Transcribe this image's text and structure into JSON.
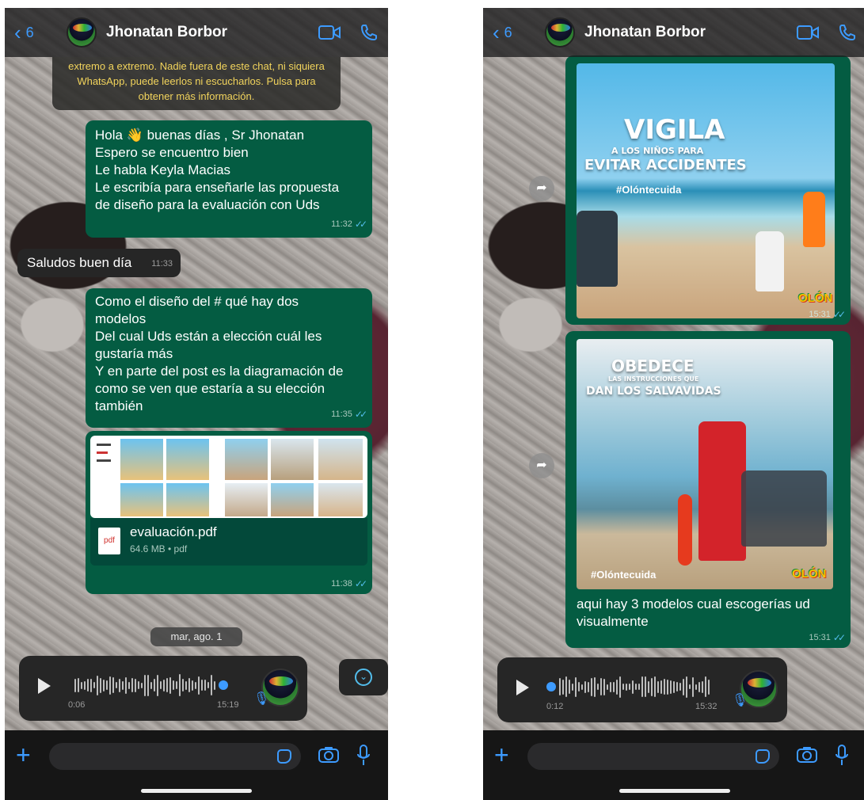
{
  "left": {
    "header": {
      "back_count": "6",
      "contact_name": "Jhonatan Borbor"
    },
    "system_notice": "extremo a extremo. Nadie fuera de este chat, ni siquiera WhatsApp, puede leerlos ni escucharlos. Pulsa para obtener más información.",
    "messages": [
      {
        "lines": [
          "Hola 👋 buenas días , Sr Jhonatan",
          "Espero se encuentro bien",
          "Le habla Keyla Macias",
          "Le escribía para enseñarle las propuesta",
          "de diseño para la evaluación con Uds"
        ],
        "time": "11:32"
      },
      {
        "text": "Saludos buen día",
        "time": "11:33"
      },
      {
        "lines": [
          "Como el diseño del # qué hay dos",
          "modelos",
          "Del cual Uds están a elección cuál les",
          "gustaría más",
          "Y en parte del post es la diagramación de",
          "como se ven que estaría a su elección",
          "también"
        ],
        "time": "11:35"
      }
    ],
    "pdf": {
      "icon_label": "pdf",
      "name": "evaluación.pdf",
      "meta": "64.6 MB • pdf",
      "time": "11:38"
    },
    "date_pill": "mar, ago. 1",
    "voice": {
      "elapsed": "0:06",
      "sent_time": "15:19"
    }
  },
  "right": {
    "header": {
      "back_count": "6",
      "contact_name": "Jhonatan Borbor"
    },
    "image1": {
      "title": "VIGILA",
      "subtitle": "A LOS NIÑOS PARA",
      "headline": "EVITAR ACCIDENTES",
      "hashtag": "#Olóntecuida",
      "logo": "OLÓN",
      "time": "15:31"
    },
    "image2": {
      "title": "OBEDECE",
      "subtitle": "LAS INSTRUCCIONES QUE",
      "headline": "DAN LOS SALVAVIDAS",
      "hashtag": "#Olóntecuida",
      "logo": "OLÓN"
    },
    "caption": {
      "lines": [
        "aqui hay 3 modelos cual escogerías ud",
        "visualmente"
      ],
      "time": "15:31"
    },
    "voice": {
      "elapsed": "0:12",
      "sent_time": "15:32"
    }
  },
  "colors": {
    "accent": "#3d9bff",
    "outgoing_bubble": "#045c42",
    "incoming_bubble": "#262626",
    "read_ticks": "#53bdeb",
    "notice_text": "#f2d45c"
  },
  "icons": [
    "chevron-left-icon",
    "video-call-icon",
    "phone-icon",
    "check-double-icon",
    "play-icon",
    "mic-icon",
    "chevron-down-icon",
    "plus-icon",
    "sticker-icon",
    "camera-icon",
    "forward-icon",
    "pdf-file-icon"
  ]
}
